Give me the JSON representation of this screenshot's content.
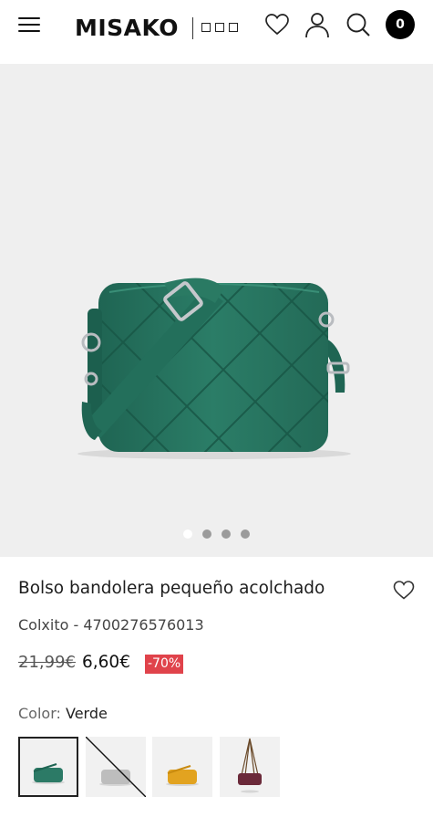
{
  "header": {
    "brand": "MISAKO",
    "cart_count": "0",
    "icons": [
      "menu-icon",
      "heart-icon",
      "user-icon",
      "search-icon"
    ]
  },
  "gallery": {
    "slide_count": 4,
    "active_slide": 1
  },
  "product": {
    "title": "Bolso bandolera pequeño acolchado",
    "subline": "Colxito - 4700276576013",
    "old_price": "21,99€",
    "new_price": "6,60€",
    "discount": "-70%",
    "color_label": "Color:",
    "color_value": "Verde"
  },
  "swatches": [
    {
      "color": "#2c7a66",
      "state": "selected"
    },
    {
      "color": "#bdbdbd",
      "state": "unavailable"
    },
    {
      "color": "#e2a320",
      "state": "available"
    },
    {
      "color": "#6b2a3a",
      "state": "available"
    }
  ],
  "colors": {
    "bag_green": "#2a7a63",
    "discount_red": "#e0434b",
    "gallery_bg": "#efefef"
  }
}
